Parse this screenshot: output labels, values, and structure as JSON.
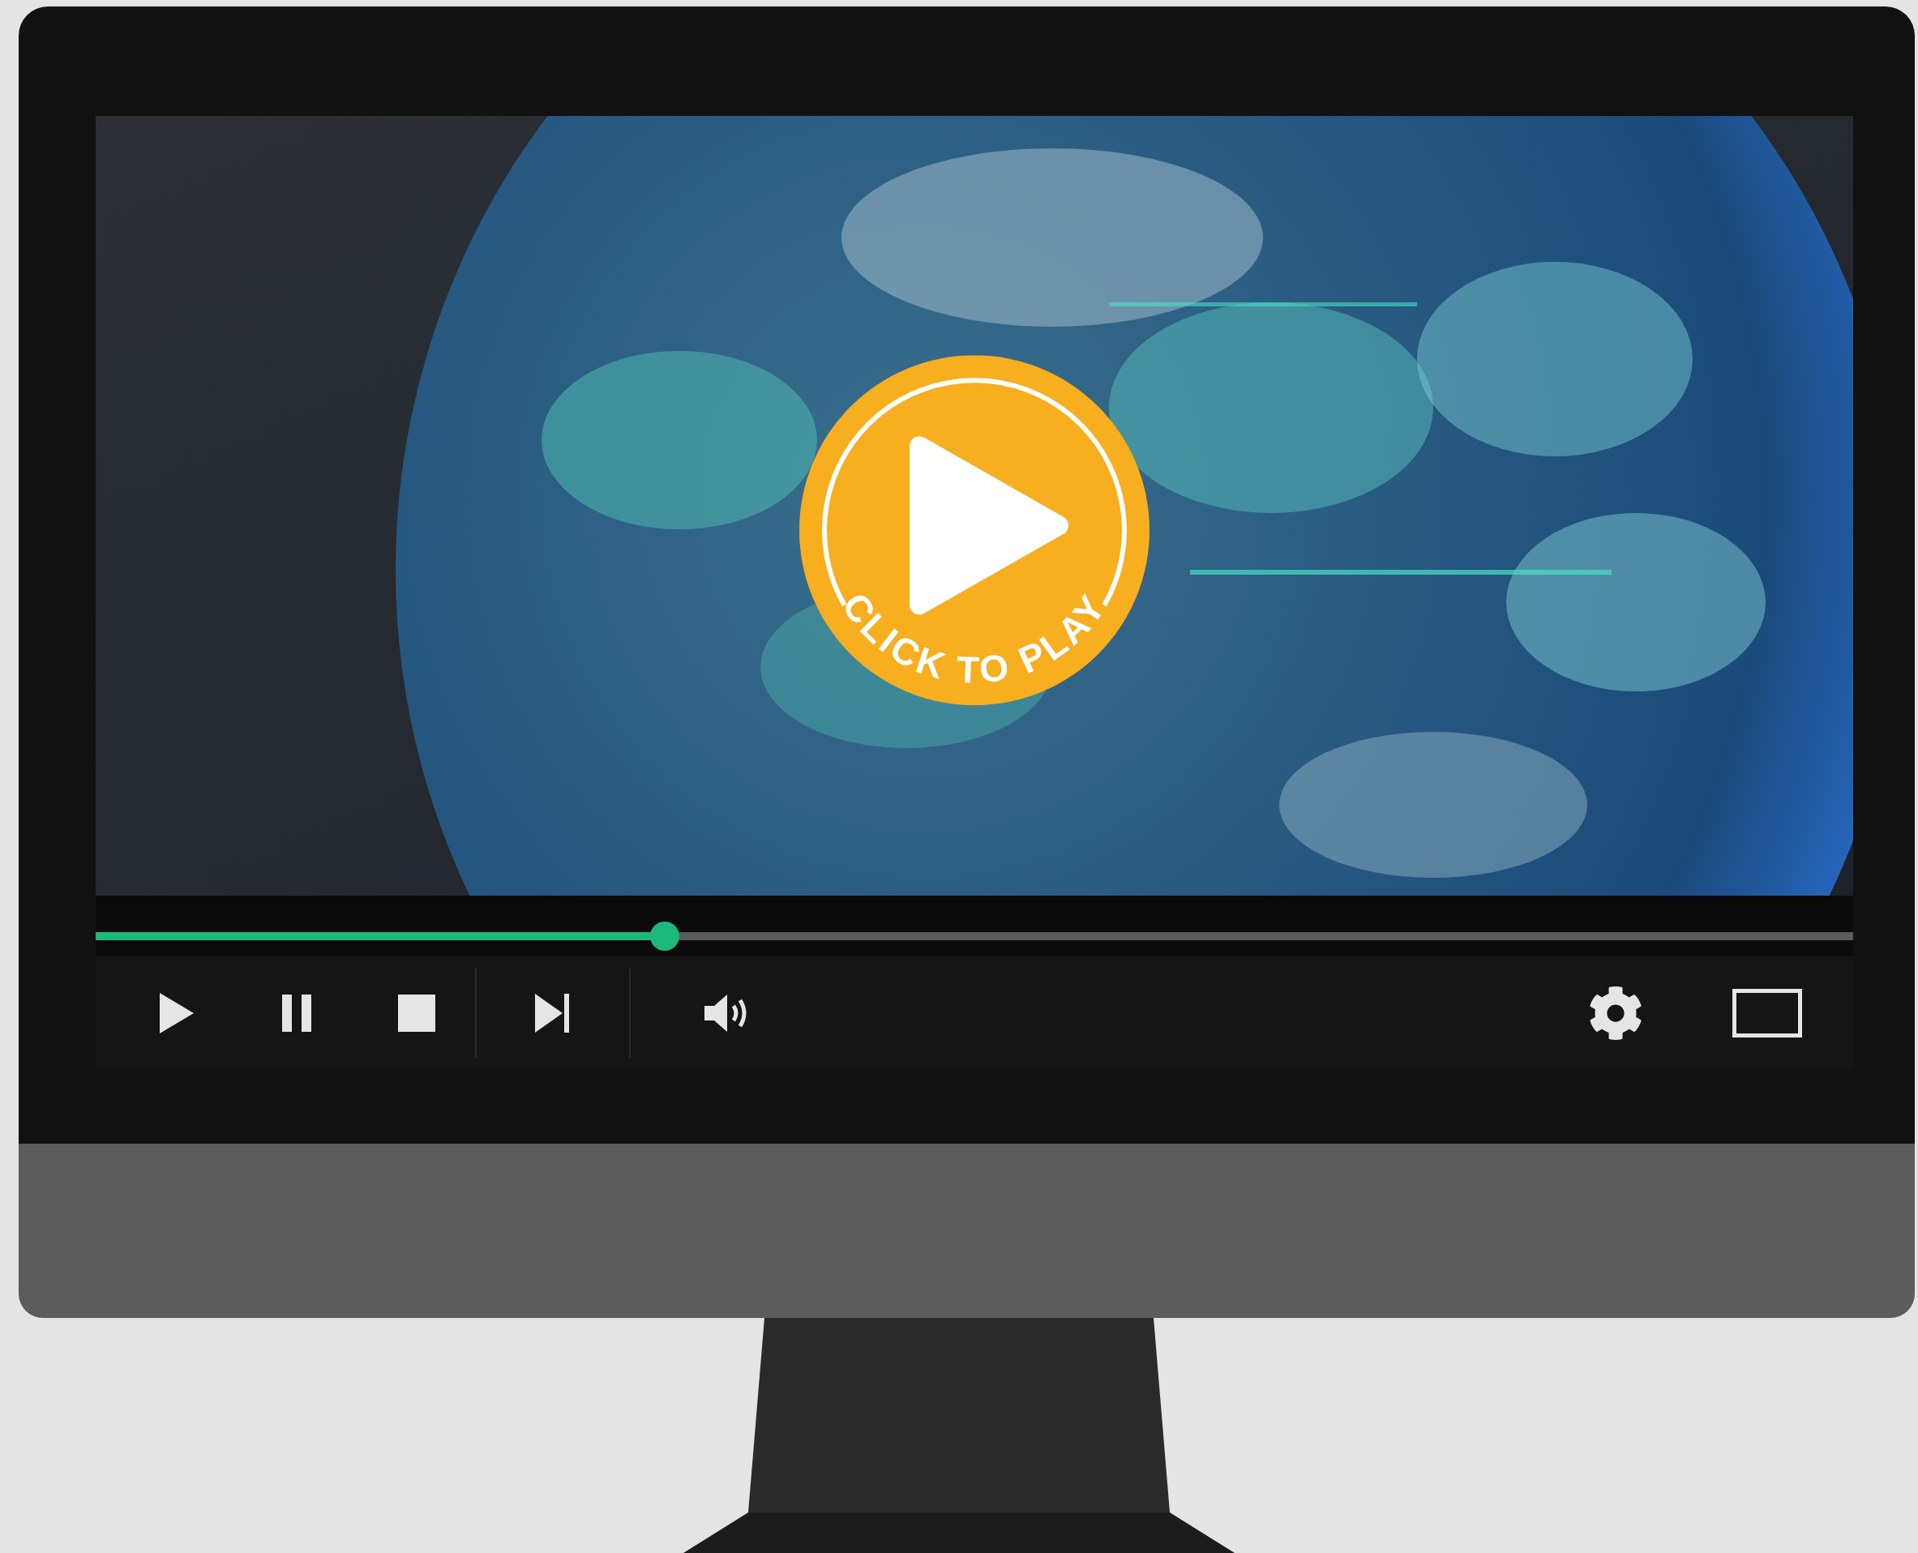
{
  "player": {
    "overlay": {
      "label": "CLICK TO PLAY"
    },
    "progress": {
      "level": 0.324
    },
    "control_groups": [
      {
        "controls": [
          {
            "kind": "play"
          },
          {
            "kind": "pause"
          },
          {
            "kind": "stop"
          }
        ]
      },
      {
        "controls": [
          {
            "kind": "next"
          }
        ]
      },
      {
        "controls": [
          {
            "kind": "volume"
          }
        ]
      }
    ],
    "right_controls": [
      {
        "kind": "settings"
      },
      {
        "kind": "fullscreen"
      }
    ]
  }
}
